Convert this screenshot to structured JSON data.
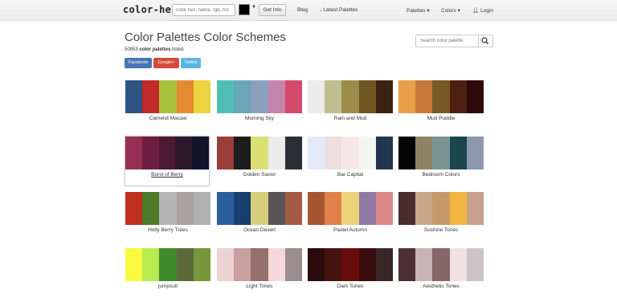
{
  "navbar": {
    "brand": "color-hex",
    "search_placeholder": "color hex, name, rgb, hsl",
    "getinfo_label": "Get Info",
    "blog": "Blog",
    "latest": "Latest Palettes",
    "palettes": "Palettes",
    "colors": "Colors",
    "login": "Login"
  },
  "header": {
    "title": "Color Palettes Color Schemes",
    "count_number": "50953",
    "count_bold": "color palettes",
    "count_tail": " listed.",
    "search_placeholder": "Search color palette"
  },
  "share": {
    "facebook": "Facebook",
    "google": "Google+",
    "twitter": "Twitter"
  },
  "palettes": [
    {
      "name": "Camelot Macaw",
      "colors": [
        "#2f5382",
        "#c22a2a",
        "#a9c13a",
        "#e58a2e",
        "#ebd43e"
      ]
    },
    {
      "name": "Morning Sky",
      "colors": [
        "#4fbfb6",
        "#6aa5b8",
        "#8aa0bc",
        "#c485ac",
        "#d44a6c"
      ]
    },
    {
      "name": "Rain and Mud",
      "colors": [
        "#ececec",
        "#c0be8e",
        "#9b8d4a",
        "#6f5622",
        "#3c2214"
      ]
    },
    {
      "name": "Mud Puddle",
      "colors": [
        "#e8a048",
        "#c9793a",
        "#775a23",
        "#4d1f10",
        "#2e0a0a"
      ]
    },
    {
      "name": "Burst of Berry",
      "colors": [
        "#972f55",
        "#6d1e41",
        "#4d1833",
        "#2c1a2c",
        "#14152a"
      ]
    },
    {
      "name": "Golden Savior",
      "colors": [
        "#9a3e3a",
        "#1d1d1d",
        "#dbe073",
        "#ececec",
        "#2a2e36"
      ]
    },
    {
      "name": "Bar Capital",
      "colors": [
        "#e3eaf8",
        "#ecdfe0",
        "#f6e8e8",
        "#f1f6ee",
        "#22344f"
      ]
    },
    {
      "name": "Bedroom Colors",
      "colors": [
        "#050505",
        "#8c8463",
        "#7a9494",
        "#1b464d",
        "#8a97ac"
      ]
    },
    {
      "name": "Holly Berry Trees",
      "colors": [
        "#c0301e",
        "#4b7a28",
        "#b4b4b4",
        "#a8a2a0",
        "#b1b1b1"
      ]
    },
    {
      "name": "Ocean Desert",
      "colors": [
        "#2a5f9c",
        "#173e6e",
        "#d4cf7a",
        "#5a5456",
        "#a35a42"
      ]
    },
    {
      "name": "Pastel Autumn",
      "colors": [
        "#a75532",
        "#e0814c",
        "#ecd37a",
        "#8f7aa4",
        "#dc8686"
      ]
    },
    {
      "name": "Sushine Tones",
      "colors": [
        "#4a2d2d",
        "#c8a888",
        "#c89a6a",
        "#f2b540",
        "#c8a08e"
      ]
    },
    {
      "name": "jumpsuit",
      "colors": [
        "#f9f940",
        "#b8ec4e",
        "#3f8a2a",
        "#5c6a3a",
        "#79963a"
      ]
    },
    {
      "name": "Light Tones",
      "colors": [
        "#ecd2d2",
        "#c8a0a0",
        "#96706e",
        "#f6d8da",
        "#9c8e8e"
      ]
    },
    {
      "name": "Dark Tones",
      "colors": [
        "#2a0a0a",
        "#46130f",
        "#6a0d0d",
        "#3a0e0e",
        "#3a2828"
      ]
    },
    {
      "name": "Aesthetic Tones",
      "colors": [
        "#4e3034",
        "#c8b4b6",
        "#866666",
        "#f0e2e2",
        "#cfc3ca"
      ]
    }
  ]
}
